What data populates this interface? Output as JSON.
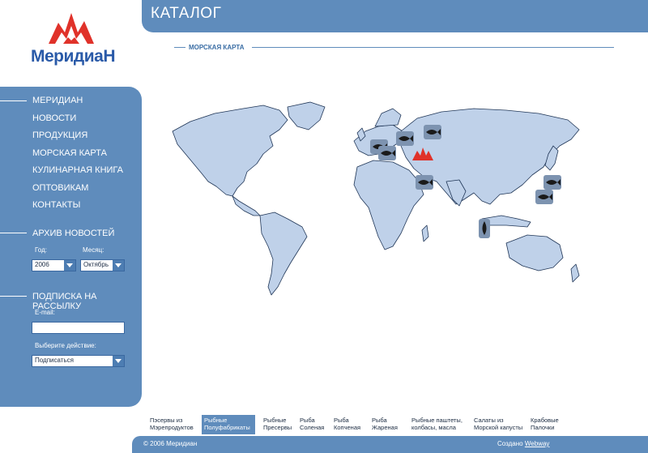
{
  "brand": {
    "name": "МеридиаН",
    "accent": "#5f8cbc",
    "logo_red": "#e0322a"
  },
  "header": {
    "title": "КАТАЛОГ"
  },
  "section": {
    "subtitle": "МОРСКАЯ КАРТА"
  },
  "sidebar": {
    "nav": [
      {
        "label": "МЕРИДИАН"
      },
      {
        "label": "НОВОСТИ"
      },
      {
        "label": "ПРОДУКЦИЯ"
      },
      {
        "label": "МОРСКАЯ КАРТА"
      },
      {
        "label": "КУЛИНАРНАЯ КНИГА"
      },
      {
        "label": "ОПТОВИКАМ"
      },
      {
        "label": "КОНТАКТЫ"
      }
    ],
    "archive": {
      "title": "АРХИВ НОВОСТЕЙ",
      "year_label": "Год:",
      "month_label": "Месяц:",
      "year_value": "2006",
      "month_value": "Октябрь"
    },
    "subscribe": {
      "title": "ПОДПИСКА НА РАССЫЛКУ",
      "email_label": "E-mail:",
      "email_value": "",
      "action_label": "Выберите действие:",
      "action_value": "Подписаться"
    }
  },
  "map": {
    "ocean_color": "#ffffff",
    "land_color": "#bfd1e9",
    "fish_markers": 9,
    "icons": [
      "world-map",
      "fish-marker-icon",
      "company-logo-marker"
    ]
  },
  "categories": [
    {
      "label": "Пэсервы из\nМэрепродуктов",
      "active": false
    },
    {
      "label": "Рыбные\nПолуфабрикаты",
      "active": true
    },
    {
      "label": "Рыбные\nПресервы",
      "active": false
    },
    {
      "label": "Рыба\nСоленая",
      "active": false
    },
    {
      "label": "Рыба\nКопченая",
      "active": false
    },
    {
      "label": "Рыба\nЖареная",
      "active": false
    },
    {
      "label": "Рыбные паштеты,\nколбасы, масла",
      "active": false
    },
    {
      "label": "Салаты из\nМорской капусты",
      "active": false
    },
    {
      "label": "Крабовые\nПалочки",
      "active": false
    }
  ],
  "footer": {
    "copyright": "© 2006 Меридиан",
    "credit_prefix": "Создано",
    "credit_link": "Webway"
  }
}
